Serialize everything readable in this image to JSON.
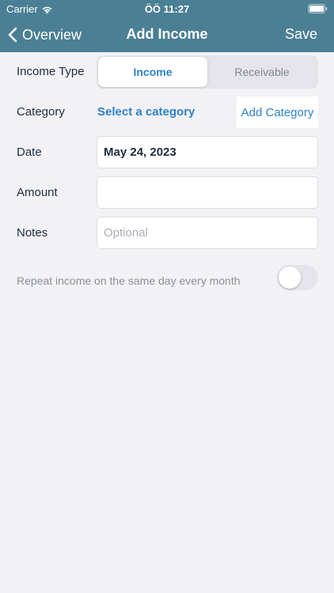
{
  "status_bar": {
    "carrier": "Carrier",
    "time": "ÖÖ 11:27",
    "wifi_icon": "wifi-icon",
    "battery_icon": "battery-icon"
  },
  "nav": {
    "back_label": "Overview",
    "title": "Add Income",
    "save_label": "Save",
    "back_icon": "chevron-left-icon",
    "bar_color": "#4b7f93"
  },
  "form": {
    "income_type": {
      "label": "Income Type",
      "options": [
        "Income",
        "Receivable"
      ],
      "selected": "Income"
    },
    "category": {
      "label": "Category",
      "placeholder": "Select a category",
      "add_button_label": "Add Category"
    },
    "date": {
      "label": "Date",
      "value": "May 24, 2023"
    },
    "amount": {
      "label": "Amount",
      "value": ""
    },
    "notes": {
      "label": "Notes",
      "placeholder": "Optional",
      "value": ""
    },
    "repeat": {
      "label": "Repeat income on the same day every month",
      "enabled": false
    }
  },
  "colors": {
    "accent": "#2c82c8",
    "background": "#f2f1f6"
  }
}
